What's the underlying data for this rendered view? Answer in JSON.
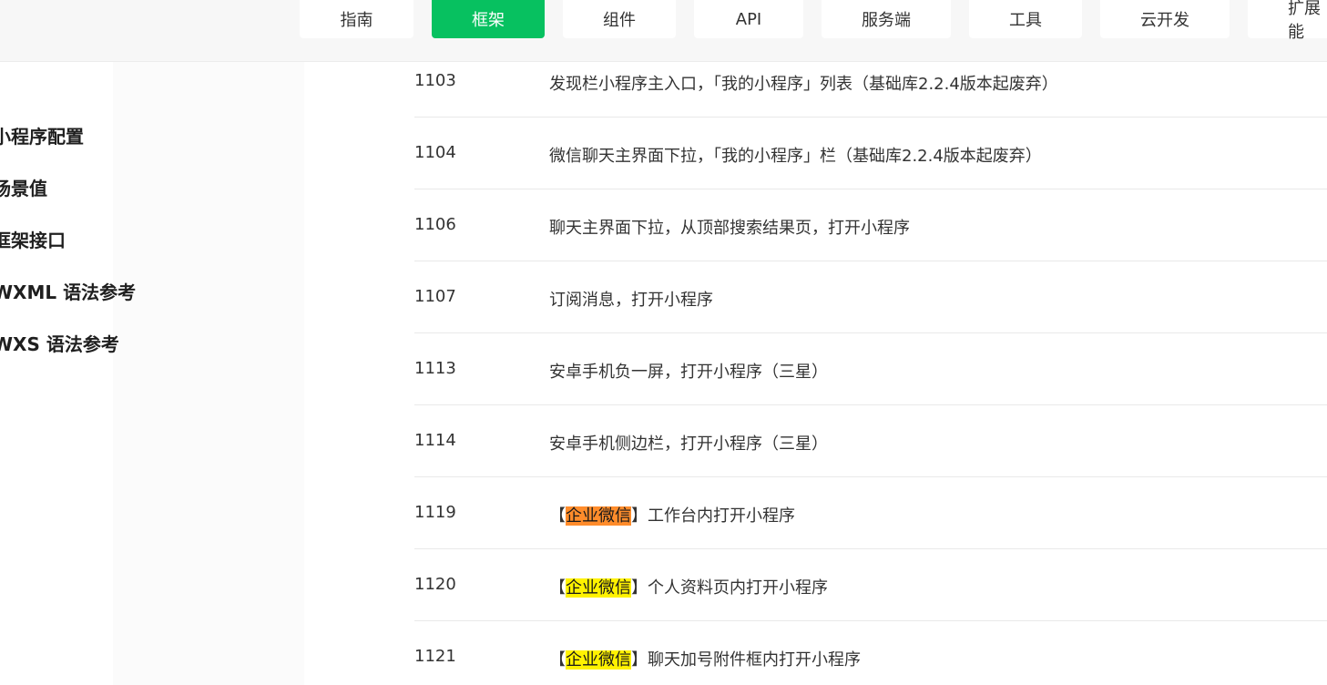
{
  "nav": {
    "tabs": [
      {
        "label": "指南",
        "active": false
      },
      {
        "label": "框架",
        "active": true
      },
      {
        "label": "组件",
        "active": false
      },
      {
        "label": "API",
        "active": false
      },
      {
        "label": "服务端",
        "active": false
      },
      {
        "label": "工具",
        "active": false
      },
      {
        "label": "云开发",
        "active": false
      },
      {
        "label": "扩展能",
        "active": false
      }
    ],
    "accent_color": "#07c160"
  },
  "sidebar": {
    "items": [
      "小程序配置",
      "场景值",
      "框架接口",
      "WXML 语法参考",
      "WXS 语法参考"
    ]
  },
  "table": {
    "rows": [
      {
        "code": "1103",
        "desc": "发现栏小程序主入口，「我的小程序」列表（基础库2.2.4版本起废弃）"
      },
      {
        "code": "1104",
        "desc": "微信聊天主界面下拉，「我的小程序」栏（基础库2.2.4版本起废弃）"
      },
      {
        "code": "1106",
        "desc": "聊天主界面下拉，从顶部搜索结果页，打开小程序"
      },
      {
        "code": "1107",
        "desc": "订阅消息，打开小程序"
      },
      {
        "code": "1113",
        "desc": "安卓手机负一屏，打开小程序（三星）"
      },
      {
        "code": "1114",
        "desc": "安卓手机侧边栏，打开小程序（三星）"
      },
      {
        "code": "1119",
        "prefix": "【",
        "highlight": "企业微信",
        "suffix": "】工作台内打开小程序",
        "highlight_color": "#ff8c2b"
      },
      {
        "code": "1120",
        "prefix": "【",
        "highlight": "企业微信",
        "suffix": "】个人资料页内打开小程序",
        "highlight_color": "#fff200"
      },
      {
        "code": "1121",
        "prefix": "【",
        "highlight": "企业微信",
        "suffix": "】聊天加号附件框内打开小程序",
        "highlight_color": "#fff200"
      }
    ]
  }
}
